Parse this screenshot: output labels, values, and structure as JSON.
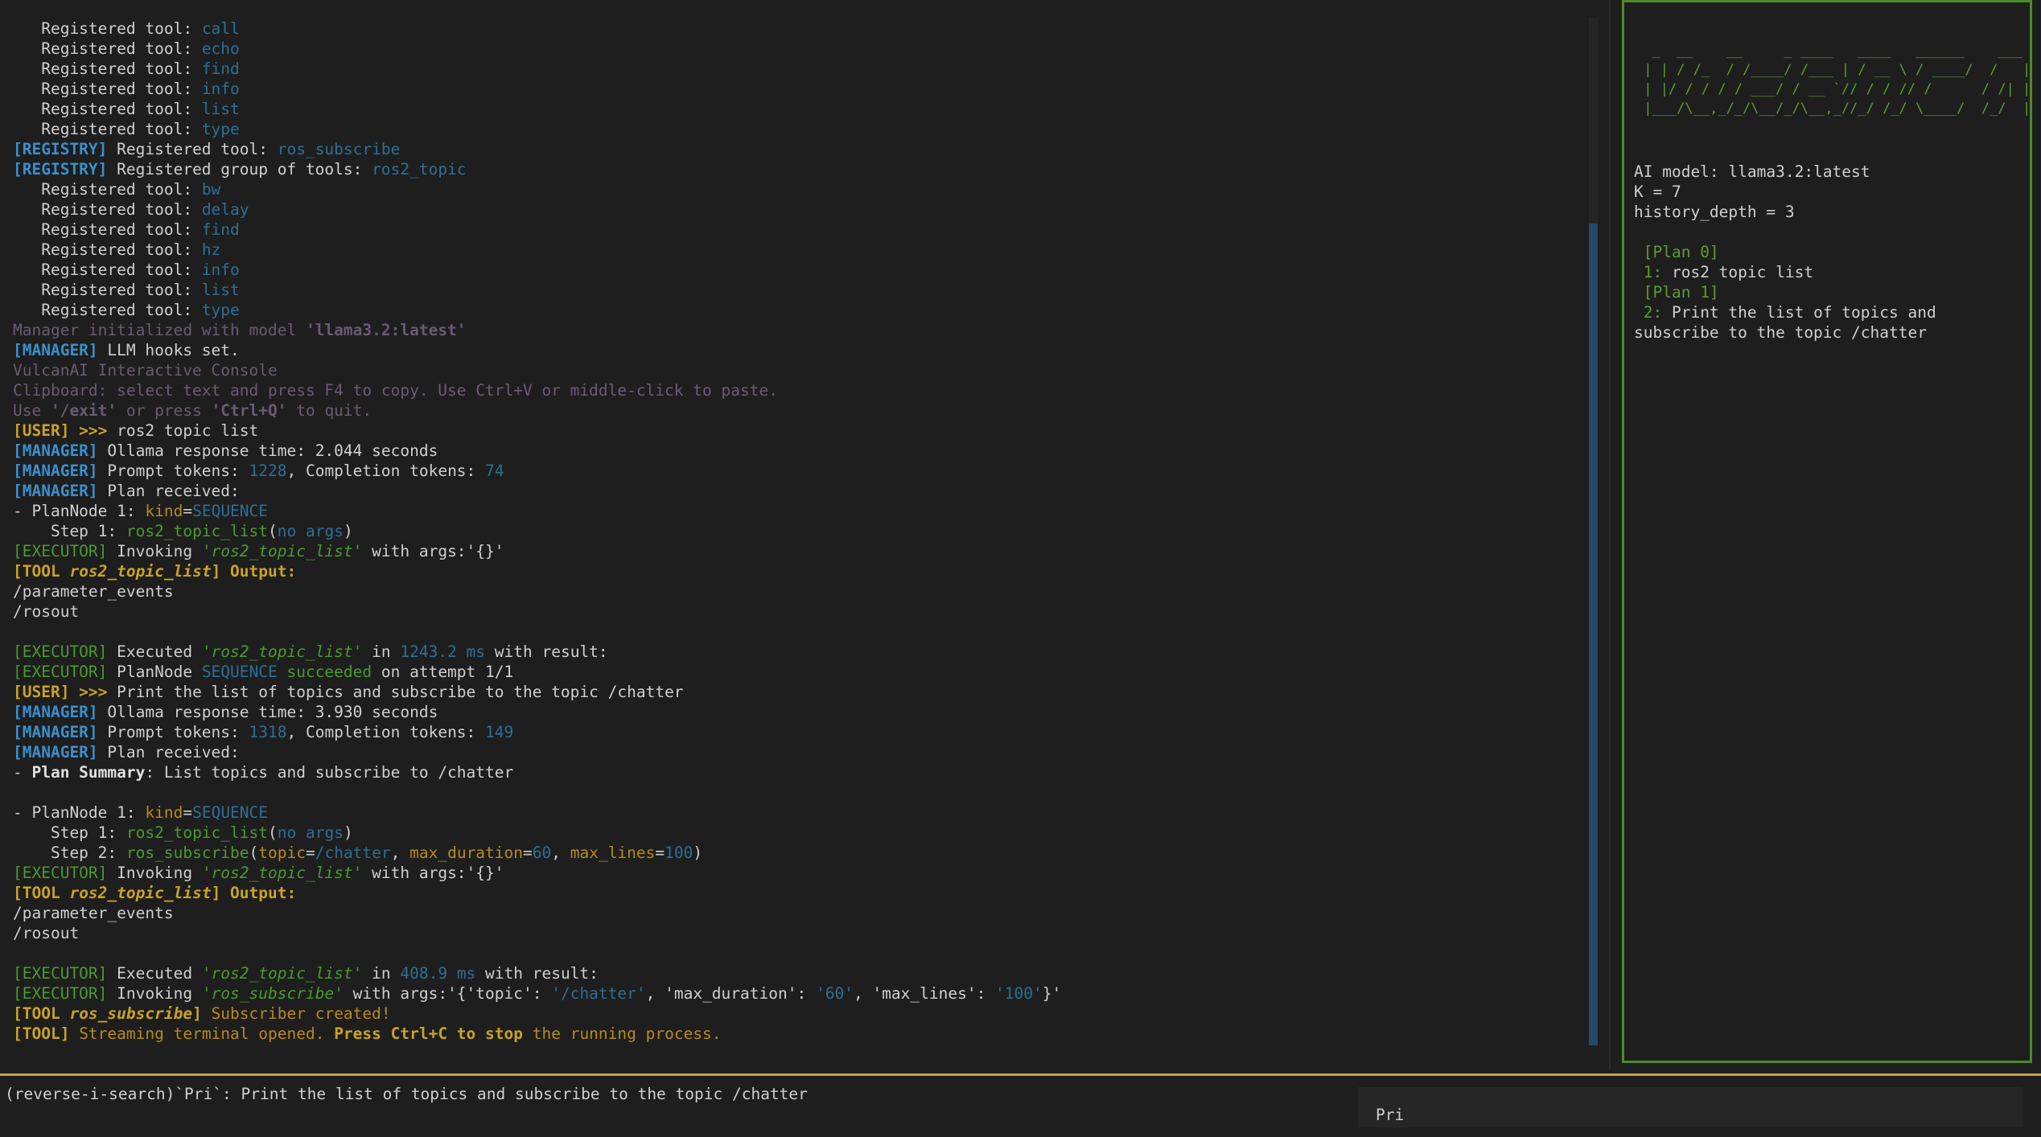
{
  "log": [
    [
      {
        "t": "   Registered tool: ",
        "c": "txt"
      },
      {
        "t": "call",
        "c": "val"
      }
    ],
    [
      {
        "t": "   Registered tool: ",
        "c": "txt"
      },
      {
        "t": "echo",
        "c": "val"
      }
    ],
    [
      {
        "t": "   Registered tool: ",
        "c": "txt"
      },
      {
        "t": "find",
        "c": "val"
      }
    ],
    [
      {
        "t": "   Registered tool: ",
        "c": "txt"
      },
      {
        "t": "info",
        "c": "val"
      }
    ],
    [
      {
        "t": "   Registered tool: ",
        "c": "txt"
      },
      {
        "t": "list",
        "c": "val"
      }
    ],
    [
      {
        "t": "   Registered tool: ",
        "c": "txt"
      },
      {
        "t": "type",
        "c": "val"
      }
    ],
    [
      {
        "t": "[REGISTRY]",
        "c": "reg"
      },
      {
        "t": " Registered tool: ",
        "c": "txt"
      },
      {
        "t": "ros_subscribe",
        "c": "val"
      }
    ],
    [
      {
        "t": "[REGISTRY]",
        "c": "reg"
      },
      {
        "t": " Registered group of tools: ",
        "c": "txt"
      },
      {
        "t": "ros2_topic",
        "c": "val"
      }
    ],
    [
      {
        "t": "   Registered tool: ",
        "c": "txt"
      },
      {
        "t": "bw",
        "c": "val"
      }
    ],
    [
      {
        "t": "   Registered tool: ",
        "c": "txt"
      },
      {
        "t": "delay",
        "c": "val"
      }
    ],
    [
      {
        "t": "   Registered tool: ",
        "c": "txt"
      },
      {
        "t": "find",
        "c": "val"
      }
    ],
    [
      {
        "t": "   Registered tool: ",
        "c": "txt"
      },
      {
        "t": "hz",
        "c": "val"
      }
    ],
    [
      {
        "t": "   Registered tool: ",
        "c": "txt"
      },
      {
        "t": "info",
        "c": "val"
      }
    ],
    [
      {
        "t": "   Registered tool: ",
        "c": "txt"
      },
      {
        "t": "list",
        "c": "val"
      }
    ],
    [
      {
        "t": "   Registered tool: ",
        "c": "txt"
      },
      {
        "t": "type",
        "c": "val"
      }
    ],
    [
      {
        "t": "Manager initialized with model ",
        "c": "dim"
      },
      {
        "t": "'llama3.2:latest'",
        "c": "quote"
      }
    ],
    [
      {
        "t": "[MANAGER]",
        "c": "mgr"
      },
      {
        "t": " LLM hooks set.",
        "c": "txt"
      }
    ],
    [
      {
        "t": "VulcanAI Interactive Console",
        "c": "dim"
      }
    ],
    [
      {
        "t": "Clipboard: select text and press F4 to copy. Use Ctrl+V or middle-click to paste.",
        "c": "dim"
      }
    ],
    [
      {
        "t": "Use ",
        "c": "dim"
      },
      {
        "t": "'/exit'",
        "c": "quote"
      },
      {
        "t": " or press ",
        "c": "dim"
      },
      {
        "t": "'Ctrl+Q'",
        "c": "quote"
      },
      {
        "t": " to quit.",
        "c": "dim"
      }
    ],
    [
      {
        "t": "[USER] >>>",
        "c": "user"
      },
      {
        "t": " ros2 topic list",
        "c": "txt"
      }
    ],
    [
      {
        "t": "[MANAGER]",
        "c": "mgr"
      },
      {
        "t": " Ollama response time: 2.044 seconds",
        "c": "txt"
      }
    ],
    [
      {
        "t": "[MANAGER]",
        "c": "mgr"
      },
      {
        "t": " Prompt tokens: ",
        "c": "txt"
      },
      {
        "t": "1228",
        "c": "val"
      },
      {
        "t": ", Completion tokens: ",
        "c": "txt"
      },
      {
        "t": "74",
        "c": "val"
      }
    ],
    [
      {
        "t": "[MANAGER]",
        "c": "mgr"
      },
      {
        "t": " Plan received:",
        "c": "txt"
      }
    ],
    [
      {
        "t": "- PlanNode 1: ",
        "c": "txt"
      },
      {
        "t": "kind",
        "c": "orange"
      },
      {
        "t": "=",
        "c": "txt"
      },
      {
        "t": "SEQUENCE",
        "c": "val"
      }
    ],
    [
      {
        "t": "    Step 1: ",
        "c": "txt"
      },
      {
        "t": "ros2_topic_list",
        "c": "green"
      },
      {
        "t": "(",
        "c": "txt"
      },
      {
        "t": "no args",
        "c": "val"
      },
      {
        "t": ")",
        "c": "txt"
      }
    ],
    [
      {
        "t": "[EXECUTOR]",
        "c": "exec"
      },
      {
        "t": " Invoking ",
        "c": "txt"
      },
      {
        "t": "'ros2_topic_list'",
        "c": "greenit"
      },
      {
        "t": " with args:'{}'",
        "c": "txt"
      }
    ],
    [
      {
        "t": "[TOOL ",
        "c": "tool"
      },
      {
        "t": "ros2_topic_list",
        "c": "tool",
        "i": true
      },
      {
        "t": "] Output:",
        "c": "tool"
      }
    ],
    [
      {
        "t": "/parameter_events",
        "c": "txt"
      }
    ],
    [
      {
        "t": "/rosout",
        "c": "txt"
      }
    ],
    [],
    [
      {
        "t": "[EXECUTOR]",
        "c": "exec"
      },
      {
        "t": " Executed ",
        "c": "txt"
      },
      {
        "t": "'ros2_topic_list'",
        "c": "greenit"
      },
      {
        "t": " in ",
        "c": "txt"
      },
      {
        "t": "1243.2 ms",
        "c": "val"
      },
      {
        "t": " with result:",
        "c": "txt"
      }
    ],
    [
      {
        "t": "[EXECUTOR]",
        "c": "exec"
      },
      {
        "t": " PlanNode ",
        "c": "txt"
      },
      {
        "t": "SEQUENCE",
        "c": "val"
      },
      {
        "t": " succeeded",
        "c": "green"
      },
      {
        "t": " on attempt 1/1",
        "c": "txt"
      }
    ],
    [
      {
        "t": "[USER] >>>",
        "c": "user"
      },
      {
        "t": " Print the list of topics and subscribe to the topic /chatter",
        "c": "txt"
      }
    ],
    [
      {
        "t": "[MANAGER]",
        "c": "mgr"
      },
      {
        "t": " Ollama response time: 3.930 seconds",
        "c": "txt"
      }
    ],
    [
      {
        "t": "[MANAGER]",
        "c": "mgr"
      },
      {
        "t": " Prompt tokens: ",
        "c": "txt"
      },
      {
        "t": "1318",
        "c": "val"
      },
      {
        "t": ", Completion tokens: ",
        "c": "txt"
      },
      {
        "t": "149",
        "c": "val"
      }
    ],
    [
      {
        "t": "[MANAGER]",
        "c": "mgr"
      },
      {
        "t": " Plan received:",
        "c": "txt"
      }
    ],
    [
      {
        "t": "- ",
        "c": "txt"
      },
      {
        "t": "Plan Summary",
        "c": "bold"
      },
      {
        "t": ": List topics and subscribe to /chatter",
        "c": "txt"
      }
    ],
    [],
    [
      {
        "t": "- PlanNode 1: ",
        "c": "txt"
      },
      {
        "t": "kind",
        "c": "orange"
      },
      {
        "t": "=",
        "c": "txt"
      },
      {
        "t": "SEQUENCE",
        "c": "val"
      }
    ],
    [
      {
        "t": "    Step 1: ",
        "c": "txt"
      },
      {
        "t": "ros2_topic_list",
        "c": "green"
      },
      {
        "t": "(",
        "c": "txt"
      },
      {
        "t": "no args",
        "c": "val"
      },
      {
        "t": ")",
        "c": "txt"
      }
    ],
    [
      {
        "t": "    Step 2: ",
        "c": "txt"
      },
      {
        "t": "ros_subscribe",
        "c": "green"
      },
      {
        "t": "(",
        "c": "txt"
      },
      {
        "t": "topic",
        "c": "orange"
      },
      {
        "t": "=",
        "c": "txt"
      },
      {
        "t": "/chatter",
        "c": "val"
      },
      {
        "t": ", ",
        "c": "txt"
      },
      {
        "t": "max_duration",
        "c": "orange"
      },
      {
        "t": "=",
        "c": "txt"
      },
      {
        "t": "60",
        "c": "val"
      },
      {
        "t": ", ",
        "c": "txt"
      },
      {
        "t": "max_lines",
        "c": "orange"
      },
      {
        "t": "=",
        "c": "txt"
      },
      {
        "t": "100",
        "c": "val"
      },
      {
        "t": ")",
        "c": "txt"
      }
    ],
    [
      {
        "t": "[EXECUTOR]",
        "c": "exec"
      },
      {
        "t": " Invoking ",
        "c": "txt"
      },
      {
        "t": "'ros2_topic_list'",
        "c": "greenit"
      },
      {
        "t": " with args:'{}'",
        "c": "txt"
      }
    ],
    [
      {
        "t": "[TOOL ",
        "c": "tool"
      },
      {
        "t": "ros2_topic_list",
        "c": "tool",
        "i": true
      },
      {
        "t": "] Output:",
        "c": "tool"
      }
    ],
    [
      {
        "t": "/parameter_events",
        "c": "txt"
      }
    ],
    [
      {
        "t": "/rosout",
        "c": "txt"
      }
    ],
    [],
    [
      {
        "t": "[EXECUTOR]",
        "c": "exec"
      },
      {
        "t": " Executed ",
        "c": "txt"
      },
      {
        "t": "'ros2_topic_list'",
        "c": "greenit"
      },
      {
        "t": " in ",
        "c": "txt"
      },
      {
        "t": "408.9 ms",
        "c": "val"
      },
      {
        "t": " with result:",
        "c": "txt"
      }
    ],
    [
      {
        "t": "[EXECUTOR]",
        "c": "exec"
      },
      {
        "t": " Invoking ",
        "c": "txt"
      },
      {
        "t": "'ros_subscribe'",
        "c": "greenit"
      },
      {
        "t": " with args:'{",
        "c": "txt"
      },
      {
        "t": "'topic'",
        "c": "txt"
      },
      {
        "t": ": ",
        "c": "txt"
      },
      {
        "t": "'/chatter'",
        "c": "val"
      },
      {
        "t": ", ",
        "c": "txt"
      },
      {
        "t": "'max_duration'",
        "c": "txt"
      },
      {
        "t": ": ",
        "c": "txt"
      },
      {
        "t": "'60'",
        "c": "val"
      },
      {
        "t": ", ",
        "c": "txt"
      },
      {
        "t": "'max_lines'",
        "c": "txt"
      },
      {
        "t": ": ",
        "c": "txt"
      },
      {
        "t": "'100'",
        "c": "val"
      },
      {
        "t": "}'",
        "c": "txt"
      }
    ],
    [
      {
        "t": "[TOOL ",
        "c": "tool"
      },
      {
        "t": "ros_subscribe",
        "c": "tool",
        "i": true
      },
      {
        "t": "]",
        "c": "tool"
      },
      {
        "t": " Subscriber created!",
        "c": "orange"
      }
    ],
    [
      {
        "t": "[TOOL]",
        "c": "tool"
      },
      {
        "t": " Streaming terminal opened. ",
        "c": "orange"
      },
      {
        "t": "Press Ctrl+C to stop",
        "c": "tool"
      },
      {
        "t": " the running process.",
        "c": "orange"
      }
    ]
  ],
  "scroll": {
    "position": 0.2,
    "visible_fraction": 0.8
  },
  "side": {
    "banner": "  _  __    __     _ ____   ____   ______    ___    ____\n | | / /_  / /____/ /___ | / __ \\ / ____/  /   |  /  _/\n | |/ / / / / ___/ / __ `// / / // /      / /| |  / /\n |___/\\__,_/_/\\__/_/\\__,_//_/ /_/ \\____/  /_/  |_|/___/",
    "model_line": "AI model: llama3.2:latest",
    "k_line": "K = 7",
    "history_line": "history_depth = 3",
    "plans": [
      {
        "header": "[Plan 0]",
        "num": "1:",
        "text": " ros2 topic list"
      },
      {
        "header": "[Plan 1]",
        "num": "2:",
        "text": " Print the list of topics and subscribe to the topic /chatter"
      }
    ]
  },
  "search": {
    "text": "(reverse-i-search)`Pri`: Print the list of topics and subscribe to the topic /chatter",
    "completion": "Pri"
  },
  "colors": {
    "accent_green": "#4d8a2b",
    "accent_yellow": "#caa047",
    "tag_blue": "#3a8fcc",
    "value_blue": "#2d6f96"
  }
}
